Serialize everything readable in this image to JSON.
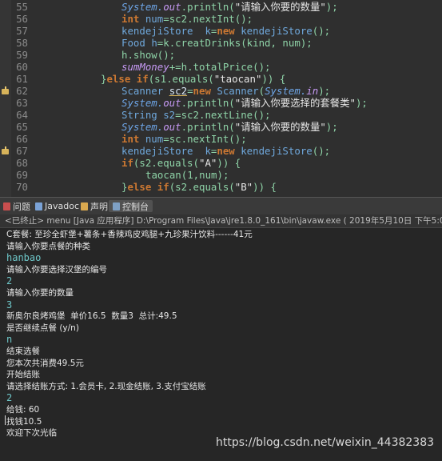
{
  "editor": {
    "line_numbers": [
      "55",
      "56",
      "57",
      "58",
      "59",
      "60",
      "61",
      "62",
      "63",
      "64",
      "65",
      "66",
      "67",
      "68",
      "69",
      "70"
    ],
    "lines": [
      [
        [
          "st",
          "System."
        ],
        [
          "vi",
          "out"
        ],
        [
          "mt",
          ".println("
        ],
        [
          "str",
          "\"请输入你要的数量\""
        ],
        [
          "mt",
          ");"
        ]
      ],
      [
        [
          "kw",
          "int "
        ],
        [
          "ty",
          "num"
        ],
        [
          "mt",
          "=sc2.nextInt();"
        ]
      ],
      [
        [
          "ty",
          "kendejiStore  "
        ],
        [
          "ty",
          "k"
        ],
        [
          "mt",
          "="
        ],
        [
          "kw",
          "new "
        ],
        [
          "ty",
          "kendejiStore"
        ],
        [
          "mt",
          "();"
        ]
      ],
      [
        [
          "ty",
          "Food "
        ],
        [
          "ty",
          "h"
        ],
        [
          "mt",
          "=k.creatDrinks(kind, num);"
        ]
      ],
      [
        [
          "mt",
          "h.show();"
        ]
      ],
      [
        [
          "vi",
          "sumMoney"
        ],
        [
          "mt",
          "+=h.totalPrice();"
        ]
      ],
      [
        [
          "mt",
          "}"
        ],
        [
          "kw",
          "else if"
        ],
        [
          "mt",
          "(s1.equals("
        ],
        [
          "str",
          "\"taocan\""
        ],
        [
          "mt",
          ")) {"
        ]
      ],
      [
        [
          "ty",
          "Scanner "
        ],
        [
          "ul",
          "sc2"
        ],
        [
          "mt",
          "="
        ],
        [
          "kw",
          "new "
        ],
        [
          "ty",
          "Scanner"
        ],
        [
          "mt",
          "("
        ],
        [
          "st",
          "System."
        ],
        [
          "vi",
          "in"
        ],
        [
          "mt",
          ");"
        ]
      ],
      [
        [
          "st",
          "System."
        ],
        [
          "vi",
          "out"
        ],
        [
          "mt",
          ".println("
        ],
        [
          "str",
          "\"请输入你要选择的套餐类\""
        ],
        [
          "mt",
          ");"
        ]
      ],
      [
        [
          "ty",
          "String "
        ],
        [
          "ty",
          "s2"
        ],
        [
          "mt",
          "=sc2.nextLine();"
        ]
      ],
      [
        [
          "st",
          "System."
        ],
        [
          "vi",
          "out"
        ],
        [
          "mt",
          ".println("
        ],
        [
          "str",
          "\"请输入你要的数量\""
        ],
        [
          "mt",
          ");"
        ]
      ],
      [
        [
          "kw",
          "int "
        ],
        [
          "ty",
          "num"
        ],
        [
          "mt",
          "=sc.nextInt();"
        ]
      ],
      [
        [
          "ty",
          "kendejiStore  "
        ],
        [
          "ty",
          "k"
        ],
        [
          "mt",
          "="
        ],
        [
          "kw",
          "new "
        ],
        [
          "ty",
          "kendejiStore"
        ],
        [
          "mt",
          "();"
        ]
      ],
      [
        [
          "kw",
          "if"
        ],
        [
          "mt",
          "(s2.equals("
        ],
        [
          "str",
          "\"A\""
        ],
        [
          "mt",
          ")) {"
        ]
      ],
      [
        [
          "mt",
          "taocan(1,num);"
        ]
      ],
      [
        [
          "mt",
          "}"
        ],
        [
          "kw",
          "else if"
        ],
        [
          "mt",
          "(s2.equals("
        ],
        [
          "str",
          "\"B\""
        ],
        [
          "mt",
          ")) {"
        ]
      ]
    ]
  },
  "tabs": [
    {
      "label": "问题",
      "color": "#c94e4e"
    },
    {
      "label": "Javadoc",
      "color": "#7aa2d6"
    },
    {
      "label": "声明",
      "color": "#d9a84f"
    },
    {
      "label": "控制台",
      "color": "#7ea0c4"
    }
  ],
  "console": {
    "header": "<已终止> menu [Java 应用程序] D:\\Program Files\\Java\\jre1.8.0_161\\bin\\javaw.exe ( 2019年5月10日 下午5:07:20 )",
    "lines": [
      {
        "text": "C套餐: 至珍全虾堡+薯条+香辣鸡皮鸡腿+九珍果汁饮料------41元",
        "type": "out"
      },
      {
        "text": "请输入你要点餐的种类",
        "type": "out"
      },
      {
        "text": "hanbao",
        "type": "in"
      },
      {
        "text": "请输入你要选择汉堡的编号",
        "type": "out"
      },
      {
        "text": "2",
        "type": "in"
      },
      {
        "text": "请输入你要的数量",
        "type": "out"
      },
      {
        "text": "3",
        "type": "in"
      },
      {
        "text": "新奥尔良烤鸡堡  单价16.5  数量3  总计:49.5",
        "type": "out"
      },
      {
        "text": "是否继续点餐 (y/n)",
        "type": "out"
      },
      {
        "text": "n",
        "type": "in"
      },
      {
        "text": "结束选餐",
        "type": "out"
      },
      {
        "text": "您本次共消费49.5元",
        "type": "out"
      },
      {
        "text": "开始结账",
        "type": "out"
      },
      {
        "text": "请选择结账方式: 1.会员卡, 2.现金结账, 3.支付宝结账",
        "type": "out"
      },
      {
        "text": "2",
        "type": "in"
      },
      {
        "text": "给钱: 60",
        "type": "out"
      },
      {
        "text": "找钱10.5",
        "type": "out"
      },
      {
        "text": "欢迎下次光临",
        "type": "out"
      }
    ]
  },
  "watermark": "https://blog.csdn.net/weixin_44382383"
}
